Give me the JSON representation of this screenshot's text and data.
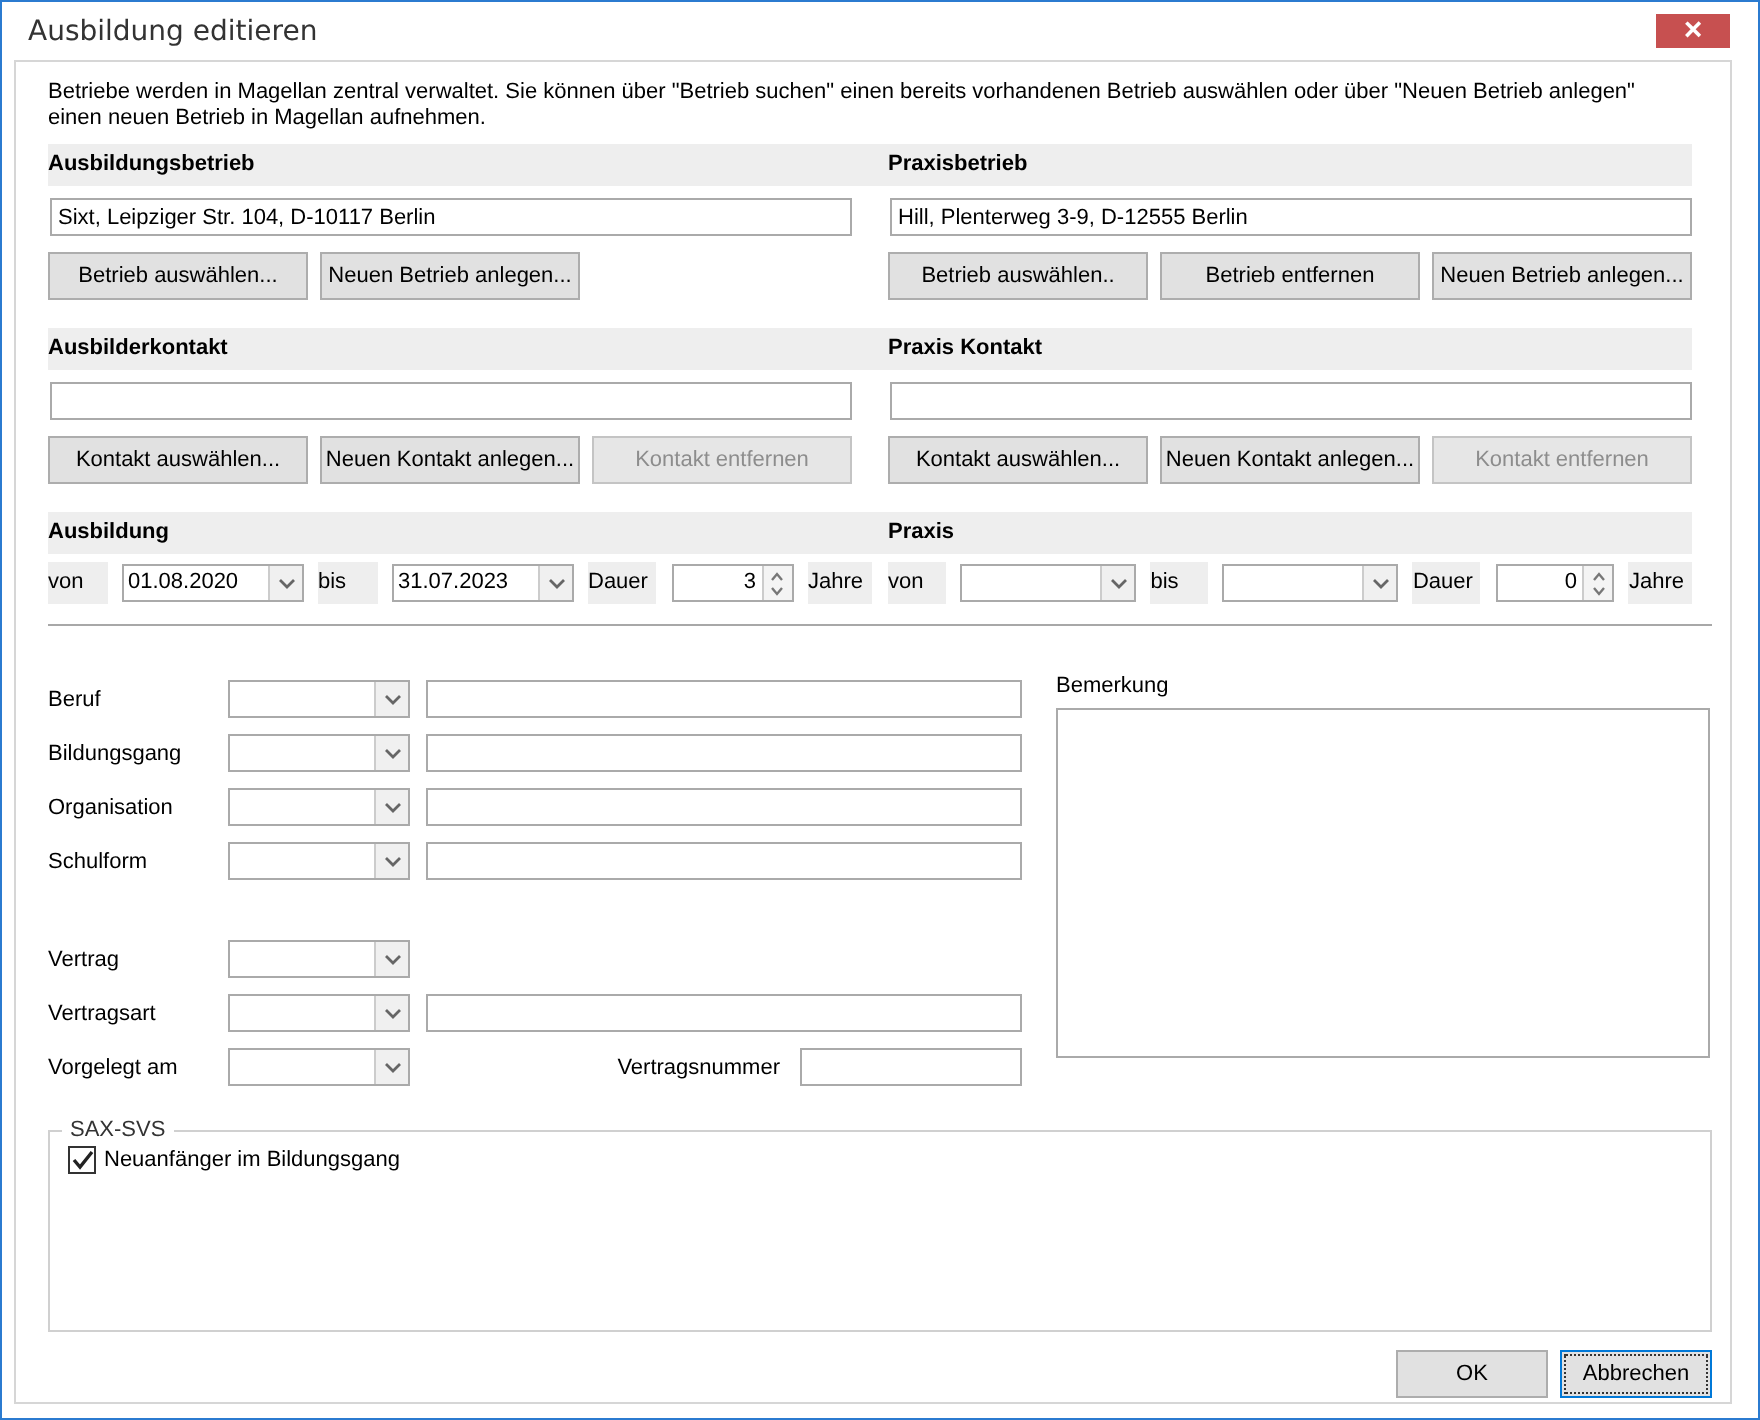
{
  "window": {
    "title": "Ausbildung editieren",
    "close": "×"
  },
  "intro": "Betriebe werden in Magellan zentral verwaltet. Sie können über \"Betrieb suchen\" einen bereits vorhandenen Betrieb auswählen oder über \"Neuen Betrieb anlegen\" einen neuen Betrieb in Magellan aufnehmen.",
  "columns": [
    {
      "blocks": [
        {
          "heading": "Ausbildungsbetrieb",
          "value": "Sixt, Leipziger Str. 104, D-10117 Berlin",
          "buttons": [
            {
              "label": "Betrieb auswählen...",
              "disabled": false
            },
            {
              "label": "Neuen Betrieb anlegen...",
              "disabled": false
            }
          ]
        },
        {
          "heading": "Ausbilderkontakt",
          "buttons": [
            {
              "label": "Kontakt auswählen...",
              "disabled": false
            },
            {
              "label": "Neuen Kontakt anlegen...",
              "disabled": false
            },
            {
              "label": "Kontakt entfernen",
              "disabled": true
            }
          ]
        }
      ],
      "period": {
        "heading": "Ausbildung",
        "from_label": "von",
        "from": "01.08.2020",
        "to_label": "bis",
        "to": "31.07.2023",
        "duration_label": "Dauer",
        "duration": "3",
        "unit": "Jahre"
      }
    },
    {
      "blocks": [
        {
          "heading": "Praxisbetrieb",
          "value": "Hill, Plenterweg 3-9, D-12555 Berlin",
          "buttons": [
            {
              "label": "Betrieb auswählen..",
              "disabled": false
            },
            {
              "label": "Betrieb entfernen",
              "disabled": false
            },
            {
              "label": "Neuen Betrieb anlegen...",
              "disabled": false
            }
          ]
        },
        {
          "heading": "Praxis Kontakt",
          "buttons": [
            {
              "label": "Kontakt auswählen...",
              "disabled": false
            },
            {
              "label": "Neuen Kontakt anlegen...",
              "disabled": false
            },
            {
              "label": "Kontakt entfernen",
              "disabled": true
            }
          ]
        }
      ],
      "period": {
        "heading": "Praxis",
        "from_label": "von",
        "to_label": "bis",
        "duration_label": "Dauer",
        "duration": "0",
        "unit": "Jahre"
      }
    }
  ],
  "form_rows": [
    {
      "kind": "combo_text",
      "label": "Beruf"
    },
    {
      "kind": "combo_text",
      "label": "Bildungsgang"
    },
    {
      "kind": "combo_text",
      "label": "Organisation"
    },
    {
      "kind": "combo_text",
      "label": "Schulform"
    },
    {
      "kind": "spacer"
    },
    {
      "kind": "combo",
      "label": "Vertrag"
    },
    {
      "kind": "combo_text",
      "label": "Vertragsart"
    },
    {
      "kind": "combo_extra",
      "label": "Vorgelegt am",
      "extra_label": "Vertragsnummer"
    }
  ],
  "remark": {
    "label": "Bemerkung"
  },
  "group": {
    "title": "SAX-SVS",
    "checkbox": {
      "label": "Neuanfänger im Bildungsgang",
      "checked": true
    }
  },
  "buttons": [
    {
      "label": "OK",
      "focused": false
    },
    {
      "label": "Abbrechen",
      "focused": true
    }
  ]
}
